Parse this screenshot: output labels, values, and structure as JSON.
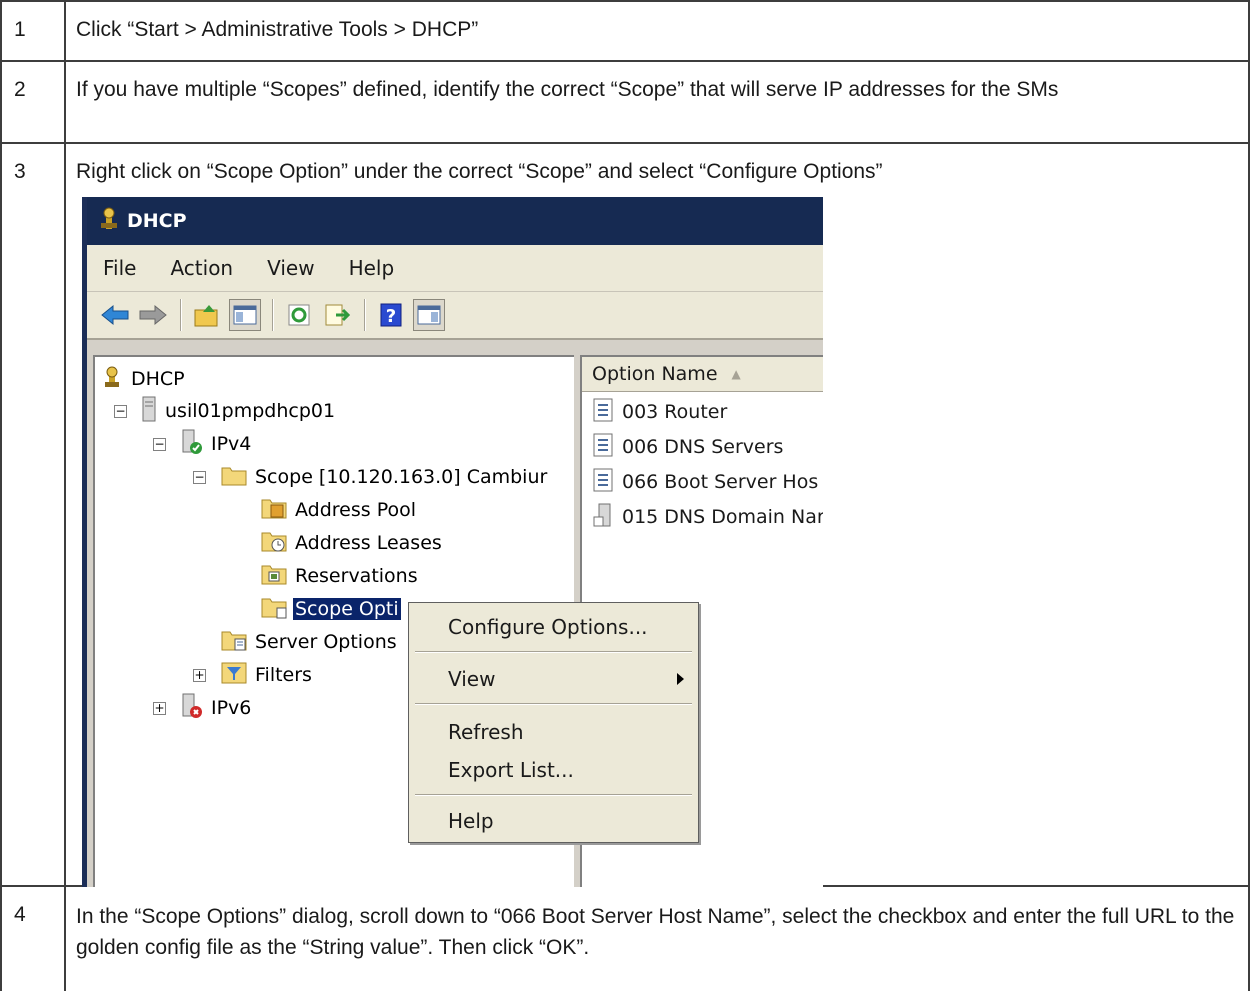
{
  "steps": [
    {
      "num": "1",
      "text": "Click “Start > Administrative Tools > DHCP”"
    },
    {
      "num": "2",
      "text": "If you have multiple “Scopes” defined, identify the correct “Scope” that will serve IP addresses for the SMs"
    },
    {
      "num": "3",
      "text": "Right click on “Scope Option” under the correct “Scope” and select “Configure Options”"
    },
    {
      "num": "4",
      "text": "In the “Scope Options” dialog, scroll down to “066 Boot Server Host Name”, select the checkbox and enter the full URL to the golden config file as the “String value”. Then click “OK”."
    }
  ],
  "window": {
    "title": "DHCP",
    "menu": [
      "File",
      "Action",
      "View",
      "Help"
    ],
    "toolbar_icons": [
      "back-arrow-icon",
      "forward-arrow-icon",
      "up-folder-icon",
      "show-hide-tree-icon",
      "refresh-icon",
      "export-list-icon",
      "help-icon",
      "action-pane-icon"
    ]
  },
  "tree": {
    "root": "DHCP",
    "server": "usil01pmpdhcp01",
    "ipv4": "IPv4",
    "scope": "Scope [10.120.163.0] Cambiur",
    "address_pool": "Address Pool",
    "address_leases": "Address Leases",
    "reservations": "Reservations",
    "scope_options": "Scope Opti",
    "server_options": "Server Options",
    "filters": "Filters",
    "ipv6": "IPv6"
  },
  "list": {
    "column": "Option Name",
    "rows": [
      "003 Router",
      "006 DNS Servers",
      "066 Boot Server Hos",
      "015 DNS Domain Nar"
    ]
  },
  "context_menu": {
    "configure": "Configure Options...",
    "view": "View",
    "refresh": "Refresh",
    "export": "Export List...",
    "help": "Help"
  }
}
